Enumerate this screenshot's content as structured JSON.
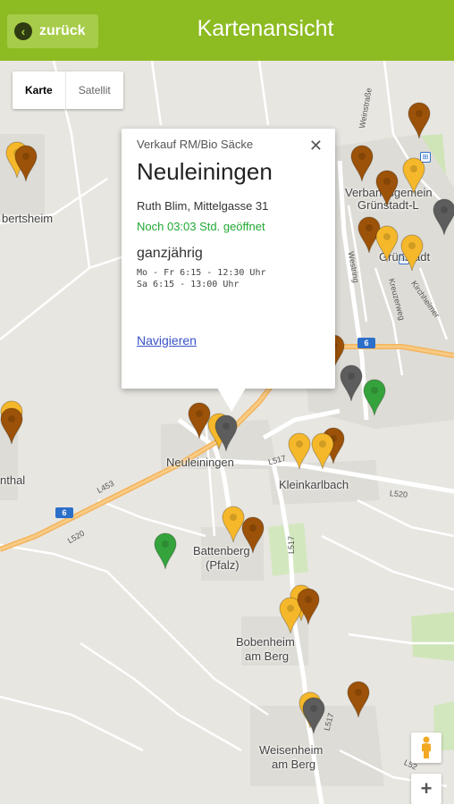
{
  "header": {
    "back_label": "zurück",
    "back_icon": "chevron-left-icon",
    "title": "Kartenansicht"
  },
  "map_type": {
    "map_label": "Karte",
    "satellite_label": "Satellit",
    "selected": "Karte"
  },
  "info_window": {
    "category": "Verkauf RM/Bio Säcke",
    "name": "Neuleiningen",
    "address": "Ruth Blim, Mittelgasse 31",
    "open_status": "Noch 03:03 Std. geöffnet",
    "season": "ganzjährig",
    "hours_weekday": "Mo - Fr 6:15 - 12:30 Uhr",
    "hours_saturday": "Sa 6:15 - 13:00 Uhr",
    "navigate_label": "Navigieren",
    "close_icon": "close-icon"
  },
  "places": {
    "neuleiningen": "Neuleiningen",
    "kleinkarlbach": "Kleinkarlbach",
    "battenberg": "Battenberg",
    "pfalz": "(Pfalz)",
    "bobenheim": "Bobenheim",
    "am_berg_1": "am Berg",
    "weisenheim": "Weisenheim",
    "am_berg_2": "am Berg",
    "bertsheim": "bertsheim",
    "nthal": "nthal",
    "verbandsgemeinde": "Verbandsgemein",
    "gruenstadt_l": "Grünstadt-L",
    "gruenstadt": "Grünstadt"
  },
  "roads": {
    "l517_a": "L517",
    "l453": "L453",
    "l520_a": "L520",
    "l520_b": "L520",
    "l517_b": "L517",
    "l517_c": "L517",
    "l52": "L52",
    "weinstrasse": "Weinstraße",
    "westring": "Westring",
    "kreuzerweg": "Kreuzerweg",
    "kirchheimer": "Kirchheimer",
    "a6_label": "6"
  },
  "controls": {
    "pegman_icon": "pegman-icon",
    "zoom_in_label": "+"
  },
  "colors": {
    "header": "#8dbb22",
    "marker_yellow": "#f6b82b",
    "marker_brown": "#9c5208",
    "marker_gray": "#5d5d5d",
    "marker_green": "#35a33c",
    "open_status": "#22a833",
    "link": "#3a52c8"
  }
}
